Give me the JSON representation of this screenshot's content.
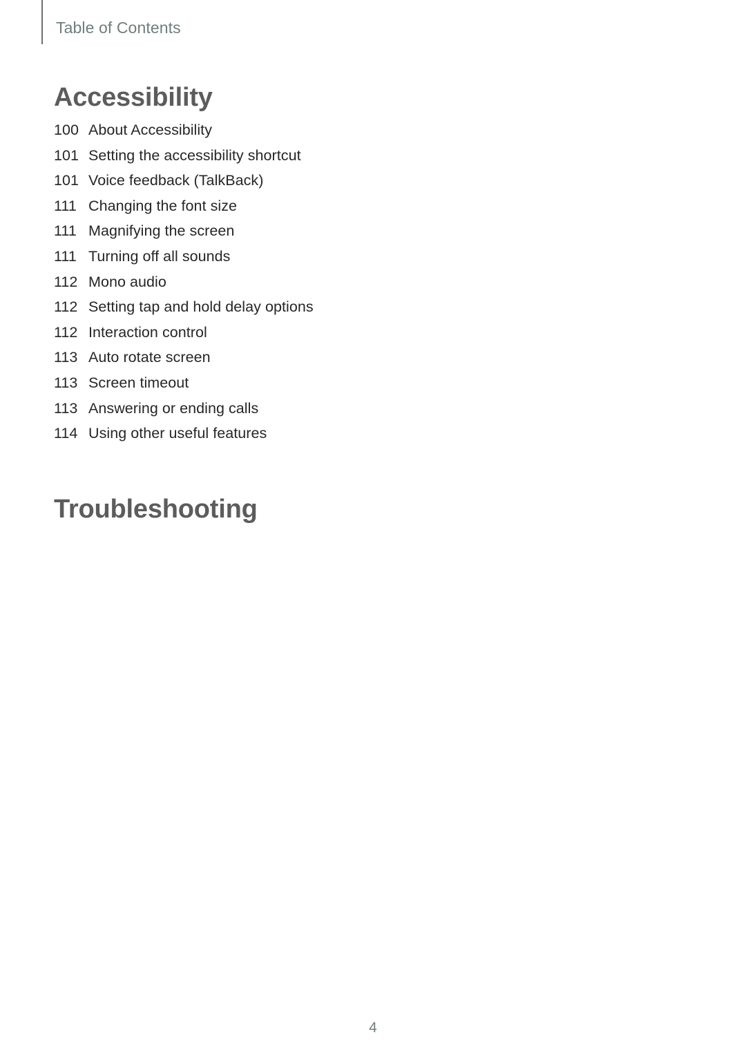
{
  "document": {
    "header_label": "Table of Contents",
    "page_number": "4",
    "colors": {
      "header_text": "#6f7d7d",
      "heading_text": "#5c5c5c",
      "body_text": "#262626",
      "rule": "#6f6f6f",
      "page_background": "#ffffff",
      "page_number_text": "#6f7d7d"
    }
  },
  "sections": [
    {
      "title": "Accessibility",
      "entries": [
        {
          "page": "100",
          "label": "About Accessibility"
        },
        {
          "page": "101",
          "label": "Setting the accessibility shortcut"
        },
        {
          "page": "101",
          "label": "Voice feedback (TalkBack)"
        },
        {
          "page": "111",
          "label": "Changing the font size"
        },
        {
          "page": "111",
          "label": "Magnifying the screen"
        },
        {
          "page": "111",
          "label": "Turning off all sounds"
        },
        {
          "page": "112",
          "label": "Mono audio"
        },
        {
          "page": "112",
          "label": "Setting tap and hold delay options"
        },
        {
          "page": "112",
          "label": "Interaction control"
        },
        {
          "page": "113",
          "label": "Auto rotate screen"
        },
        {
          "page": "113",
          "label": "Screen timeout"
        },
        {
          "page": "113",
          "label": "Answering or ending calls"
        },
        {
          "page": "114",
          "label": "Using other useful features"
        }
      ]
    },
    {
      "title": "Troubleshooting",
      "entries": []
    }
  ]
}
